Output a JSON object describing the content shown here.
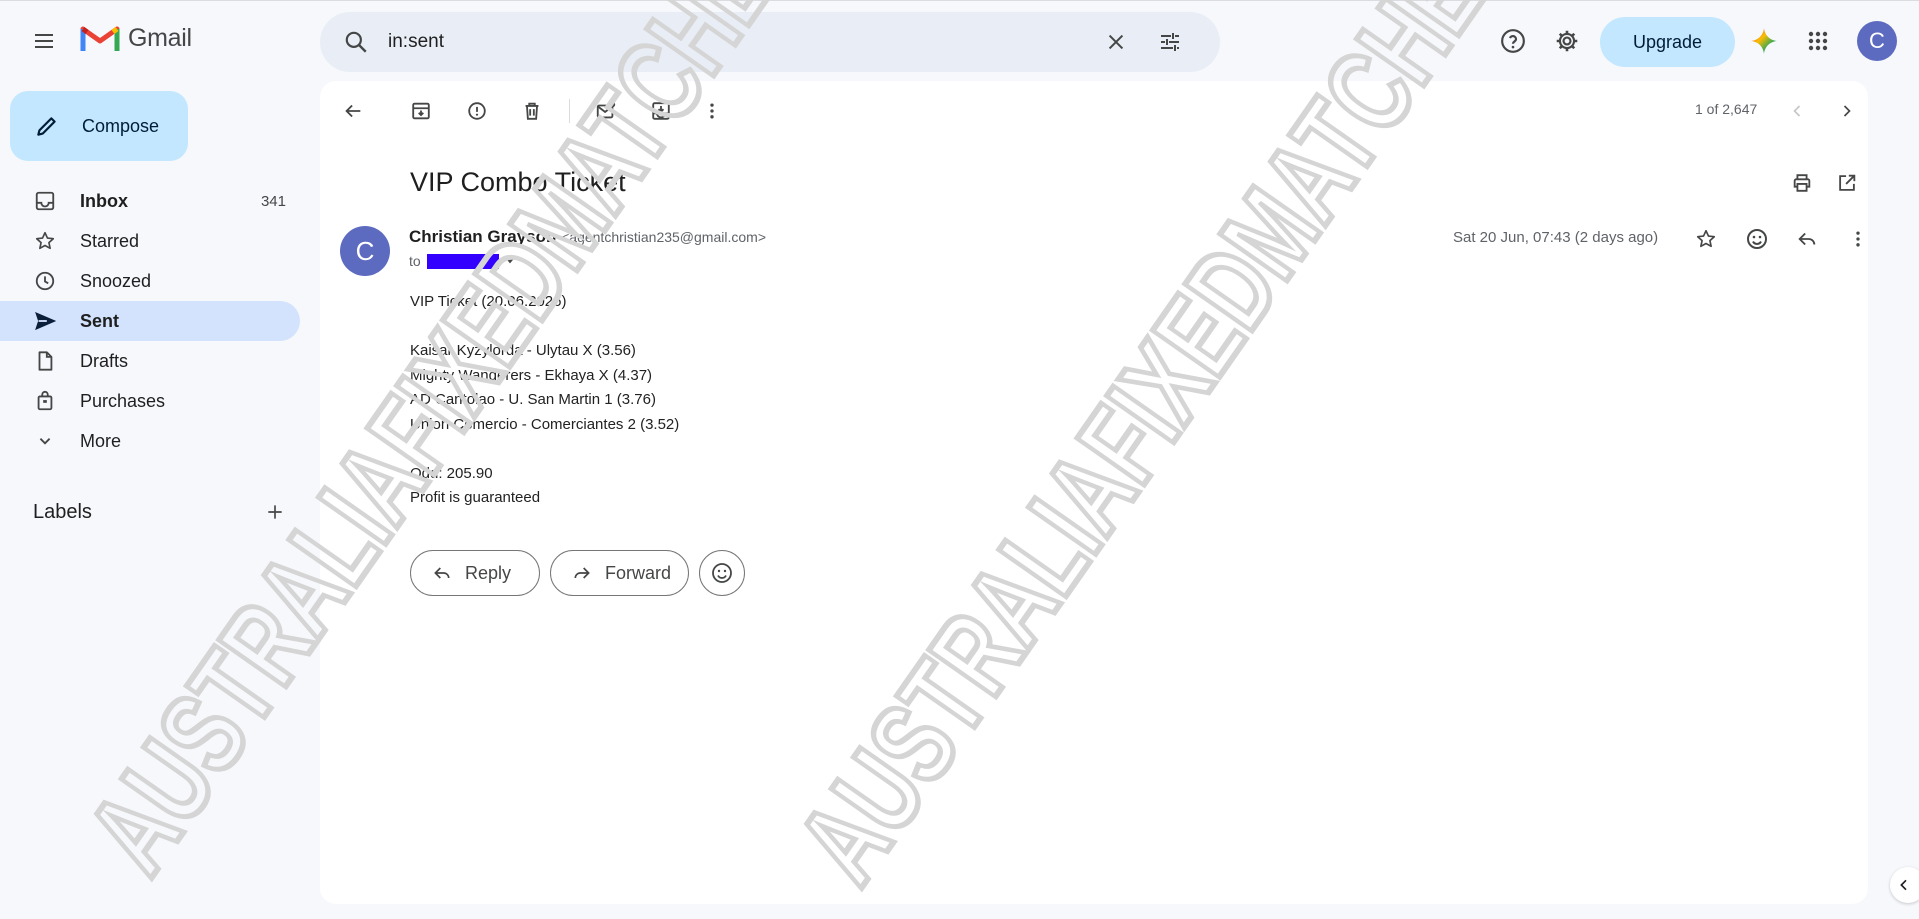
{
  "app": {
    "name": "Gmail"
  },
  "search": {
    "value": "in:sent"
  },
  "header": {
    "upgrade_label": "Upgrade",
    "avatar_letter": "C"
  },
  "sidebar": {
    "compose_label": "Compose",
    "items": [
      {
        "label": "Inbox",
        "count": "341",
        "icon": "inbox-icon"
      },
      {
        "label": "Starred",
        "count": "",
        "icon": "star-icon"
      },
      {
        "label": "Snoozed",
        "count": "",
        "icon": "clock-icon"
      },
      {
        "label": "Sent",
        "count": "",
        "icon": "send-icon"
      },
      {
        "label": "Drafts",
        "count": "",
        "icon": "draft-icon"
      },
      {
        "label": "Purchases",
        "count": "",
        "icon": "bag-icon"
      },
      {
        "label": "More",
        "count": "",
        "icon": "chevron-down-icon"
      }
    ],
    "labels_title": "Labels"
  },
  "toolbar": {
    "pager": "1 of 2,647"
  },
  "email": {
    "subject": "VIP Combo Ticket",
    "sender_name": "Christian Grayson",
    "sender_email": "<agentchristian235@gmail.com>",
    "avatar_letter": "C",
    "to_label": "to",
    "date": "Sat 20 Jun, 07:43 (2 days ago)",
    "body_lines": [
      "VIP Ticket (20.06.2026)",
      "",
      "Kaisar Kyzylorda - Ulytau  X  (3.56)",
      "Mighty Wanderers - Ekhaya  X  (4.37)",
      "AD Cantolao - U. San Martin  1  (3.76)",
      "Union Comercio - Comerciantes  2  (3.52)",
      "",
      "Odd: 205.90",
      "Profit is guaranteed"
    ],
    "reply_label": "Reply",
    "forward_label": "Forward"
  },
  "watermark": {
    "text": "AUSTRALIAFIXEDMATCHES"
  },
  "colors": {
    "accent": "#c2e7ff",
    "active_nav": "#d3e3fd",
    "avatar": "#5c6bc0",
    "redaction": "#3300ff"
  }
}
